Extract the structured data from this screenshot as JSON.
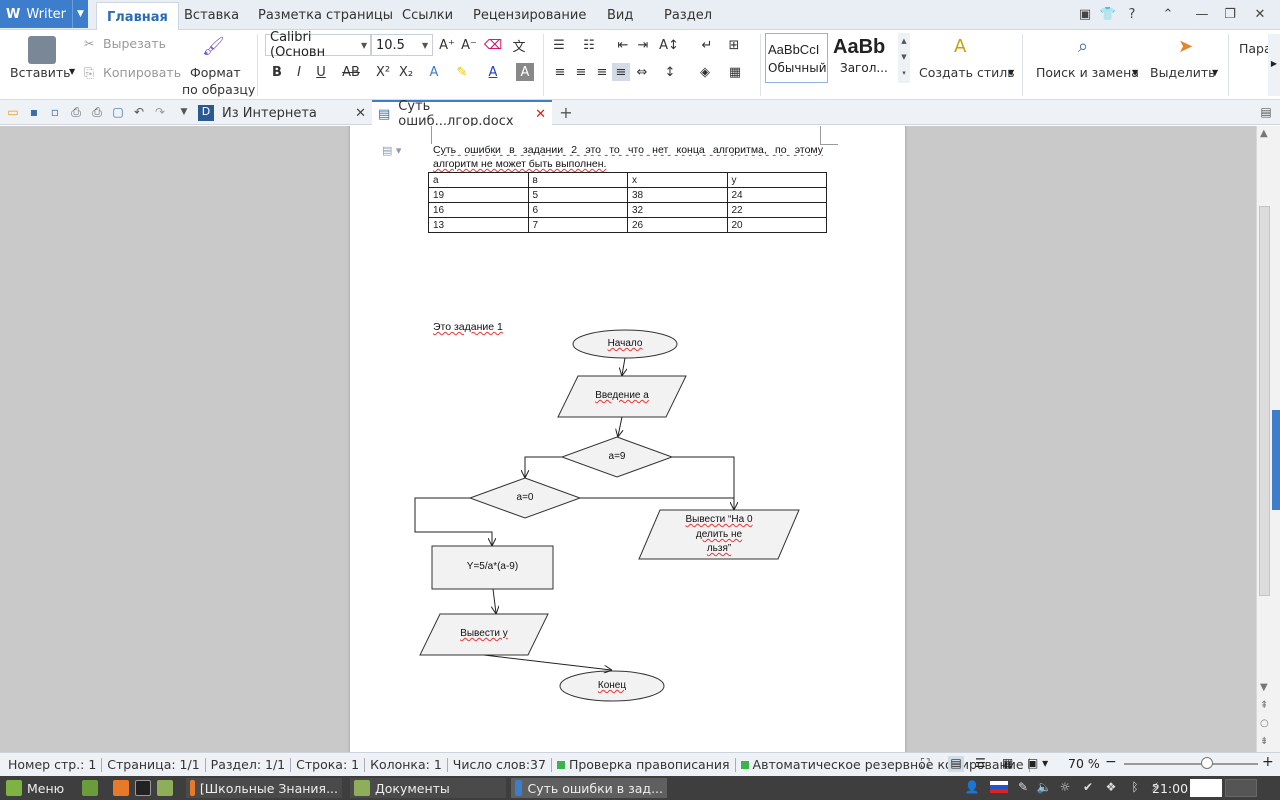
{
  "app": {
    "name": "Writer"
  },
  "ribbon_tabs": [
    "Главная",
    "Вставка",
    "Разметка страницы",
    "Ссылки",
    "Рецензирование",
    "Вид",
    "Раздел"
  ],
  "ribbon": {
    "paste": "Вставить",
    "cut": "Вырезать",
    "copy": "Копировать",
    "format_painter_1": "Формат",
    "format_painter_2": "по образцу",
    "font_name": "Calibri (Основн",
    "font_size": "10.5",
    "style_normal_preview": "AaBbCcI",
    "style_normal": "Обычный",
    "style_heading_preview": "AaBb",
    "style_heading": "Загол...",
    "create_style": "Создать стиль",
    "find_replace": "Поиск и замена",
    "select": "Выделить",
    "paragraph_cut": "Пара"
  },
  "doc_tabs": [
    {
      "label": "Из Интернета"
    },
    {
      "label": "Суть ошиб...лгор.docx"
    }
  ],
  "document": {
    "paragraph": "Суть ошибки в задании 2 это то что нет конца алгоритма, по этому алгоритм не может быть выполнен.",
    "paragraph_line1": "Суть ошибки в задании 2 это то что нет конца алгоритма, по этому",
    "paragraph_line2": "алгоритм не может быть выполнен.",
    "table": [
      [
        "а",
        "в",
        "х",
        "у"
      ],
      [
        "19",
        "5",
        "38",
        "24"
      ],
      [
        "16",
        "6",
        "32",
        "22"
      ],
      [
        "13",
        "7",
        "26",
        "20"
      ]
    ],
    "task_label": "Это задание 1",
    "flowchart": {
      "start": "Начало",
      "input": "Введение а",
      "cond1": "a=9",
      "cond2": "a=0",
      "output_error_1": "Вывести “На 0",
      "output_error_2": "делить не",
      "output_error_3": "льзя”",
      "formula": "Y=5/a*(a-9)",
      "output_y": "Вывести у",
      "end": "Конец"
    }
  },
  "statusbar": {
    "page_no": "Номер стр.: 1",
    "page": "Страница: 1/1",
    "section": "Раздел: 1/1",
    "line": "Строка: 1",
    "column": "Колонка: 1",
    "words": "Число слов:37",
    "spellcheck": "Проверка правописания",
    "backup": "Автоматическое резервное копирование",
    "zoom": "70 %",
    "zoom_value": 0.62
  },
  "taskbar": {
    "menu": "Меню",
    "task1": "[Школьные Знания...",
    "task2": "Документы",
    "task3": "Суть ошибки в зад...",
    "clock": "21:00"
  },
  "colors": {
    "accent": "#3c7ecb",
    "spell_ok": "#3bb34a"
  }
}
